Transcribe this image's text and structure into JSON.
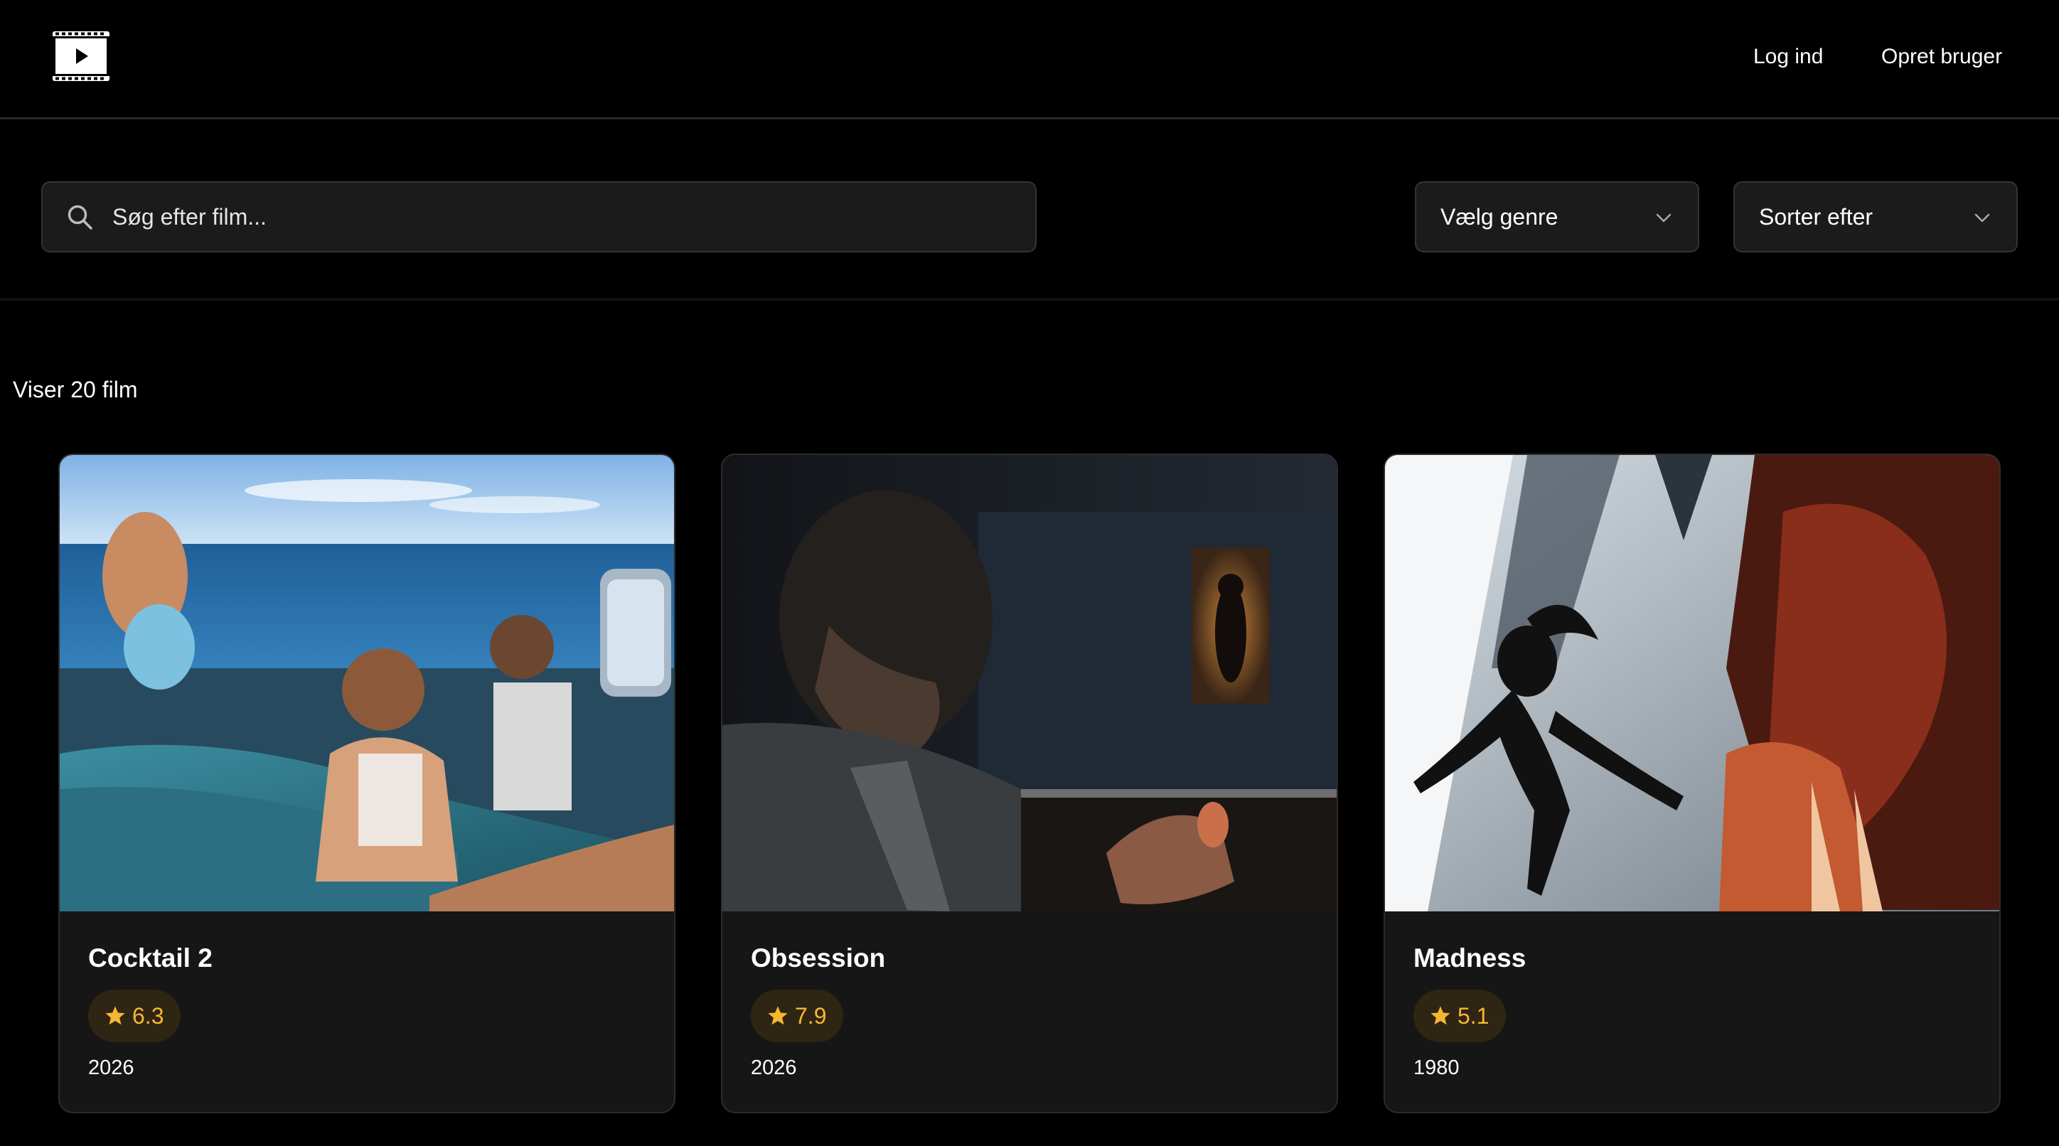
{
  "header": {
    "logo_icon": "film-play-icon",
    "login_label": "Log ind",
    "signup_label": "Opret bruger"
  },
  "filters": {
    "search_placeholder": "Søg efter film...",
    "search_value": "",
    "search_icon": "search-icon",
    "genre_label": "Vælg genre",
    "sort_label": "Sorter efter",
    "chevron_icon": "chevron-down-icon"
  },
  "results": {
    "count_label": "Viser 20 film"
  },
  "movies": [
    {
      "title": "Cocktail 2",
      "rating": "6.3",
      "year": "2026"
    },
    {
      "title": "Obsession",
      "rating": "7.9",
      "year": "2026"
    },
    {
      "title": "Madness",
      "rating": "5.1",
      "year": "1980"
    }
  ],
  "colors": {
    "background": "#000000",
    "card": "#161616",
    "rating_bg": "#2f2513",
    "rating_fg": "#f5b731"
  }
}
